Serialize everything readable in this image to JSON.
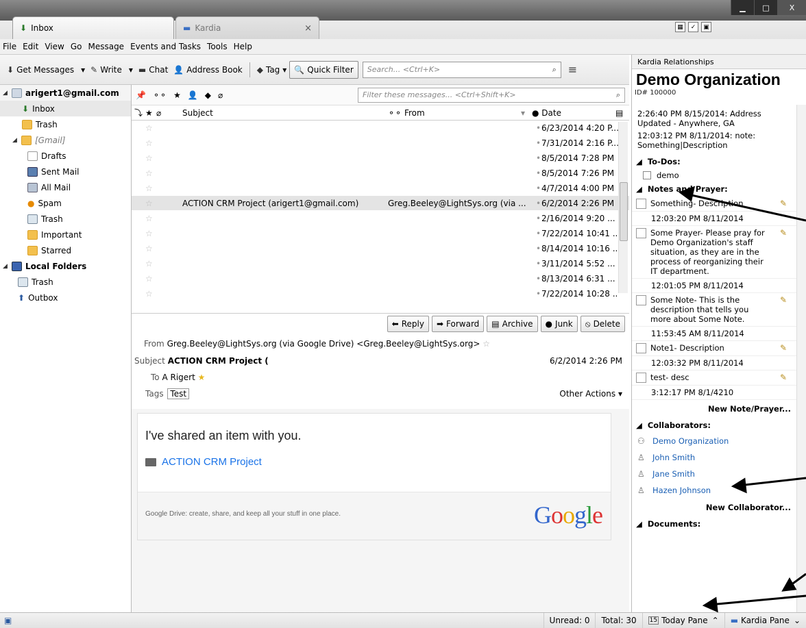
{
  "tabs": [
    {
      "label": "Inbox"
    },
    {
      "label": "Kardia",
      "close": "×"
    }
  ],
  "window_buttons": {
    "minimize": "▁",
    "maximize": "□",
    "close": "X"
  },
  "menu": [
    "File",
    "Edit",
    "View",
    "Go",
    "Message",
    "Events and Tasks",
    "Tools",
    "Help"
  ],
  "toolbar": {
    "get_messages": "Get Messages",
    "write": "Write",
    "chat": "Chat",
    "address_book": "Address Book",
    "tag": "Tag",
    "quick_filter": "Quick Filter",
    "search_placeholder": "Search... <Ctrl+K>"
  },
  "folders": {
    "account": "arigert1@gmail.com",
    "items": [
      "Inbox",
      "Trash",
      "[Gmail]",
      "Drafts",
      "Sent Mail",
      "All Mail",
      "Spam",
      "Trash",
      "Important",
      "Starred"
    ],
    "local": "Local Folders",
    "local_items": [
      "Trash",
      "Outbox"
    ]
  },
  "thread": {
    "filter_placeholder": "Filter these messages... <Ctrl+Shift+K>",
    "columns": {
      "subject": "Subject",
      "from": "From",
      "date": "Date"
    },
    "rows": [
      {
        "subject": "",
        "from": "",
        "date": "6/23/2014 4:20 P..."
      },
      {
        "subject": "",
        "from": "",
        "date": "7/31/2014 2:16 P..."
      },
      {
        "subject": "",
        "from": "",
        "date": "8/5/2014 7:28 PM"
      },
      {
        "subject": "",
        "from": "",
        "date": "8/5/2014 7:26 PM"
      },
      {
        "subject": "",
        "from": "",
        "date": "4/7/2014 4:00 PM"
      },
      {
        "subject": "ACTION CRM Project (arigert1@gmail.com)",
        "from": "Greg.Beeley@LightSys.org (via ...",
        "date": "6/2/2014 2:26 PM"
      },
      {
        "subject": "",
        "from": "",
        "date": "2/16/2014 9:20 ..."
      },
      {
        "subject": "",
        "from": "",
        "date": "7/22/2014 10:41 ..."
      },
      {
        "subject": "",
        "from": "",
        "date": "8/14/2014 10:16 ..."
      },
      {
        "subject": "",
        "from": "",
        "date": "3/11/2014 5:52 ..."
      },
      {
        "subject": "",
        "from": "",
        "date": "8/13/2014 6:31 ..."
      },
      {
        "subject": "",
        "from": "",
        "date": "7/22/2014 10:28 ..."
      }
    ]
  },
  "header": {
    "actions": [
      "Reply",
      "Forward",
      "Archive",
      "Junk",
      "Delete"
    ],
    "from_label": "From",
    "from": "Greg.Beeley@LightSys.org (via Google Drive) <Greg.Beeley@LightSys.org>",
    "subject_label": "Subject",
    "subject": "ACTION CRM Project (",
    "date": "6/2/2014 2:26 PM",
    "to_label": "To",
    "to": "A Rigert",
    "tags_label": "Tags",
    "tag": "Test",
    "other_actions": "Other Actions"
  },
  "body": {
    "line1": "I've shared an item with you.",
    "link": "ACTION CRM Project",
    "footer": "Google Drive: create, share, and keep all your stuff in one place.",
    "logo": "Google"
  },
  "kardia": {
    "pane_title": "Kardia Relationships",
    "org": "Demo Organization",
    "id": "ID# 100000",
    "history": [
      "2:26:40 PM 8/15/2014: Address Updated - Anywhere, GA",
      "12:03:12 PM 8/11/2014: note: Something|Description"
    ],
    "todos_label": "To-Dos:",
    "todos": [
      "demo"
    ],
    "notes_label": "Notes and Prayer:",
    "notes": [
      {
        "text": "Something- Description",
        "time": "12:03:20 PM 8/11/2014"
      },
      {
        "text": "Some Prayer- Please pray for Demo Organization's staff situation, as they are in the process of reorganizing their IT department.",
        "time": "12:01:05 PM 8/11/2014"
      },
      {
        "text": "Some Note- This is the description that tells you more about Some Note.",
        "time": "11:53:45 AM 8/11/2014"
      },
      {
        "text": "Note1- Description",
        "time": "12:03:32 PM 8/11/2014"
      },
      {
        "text": "test- desc",
        "time": "3:12:17 PM 8/1/4210"
      }
    ],
    "new_note": "New Note/Prayer...",
    "collab_label": "Collaborators:",
    "collaborators": [
      "Demo Organization",
      "John Smith",
      "Jane Smith",
      "Hazen Johnson"
    ],
    "new_collab": "New Collaborator...",
    "docs_label": "Documents:"
  },
  "status": {
    "unread": "Unread: 0",
    "total": "Total: 30",
    "today": "Today Pane",
    "kardia": "Kardia Pane"
  }
}
